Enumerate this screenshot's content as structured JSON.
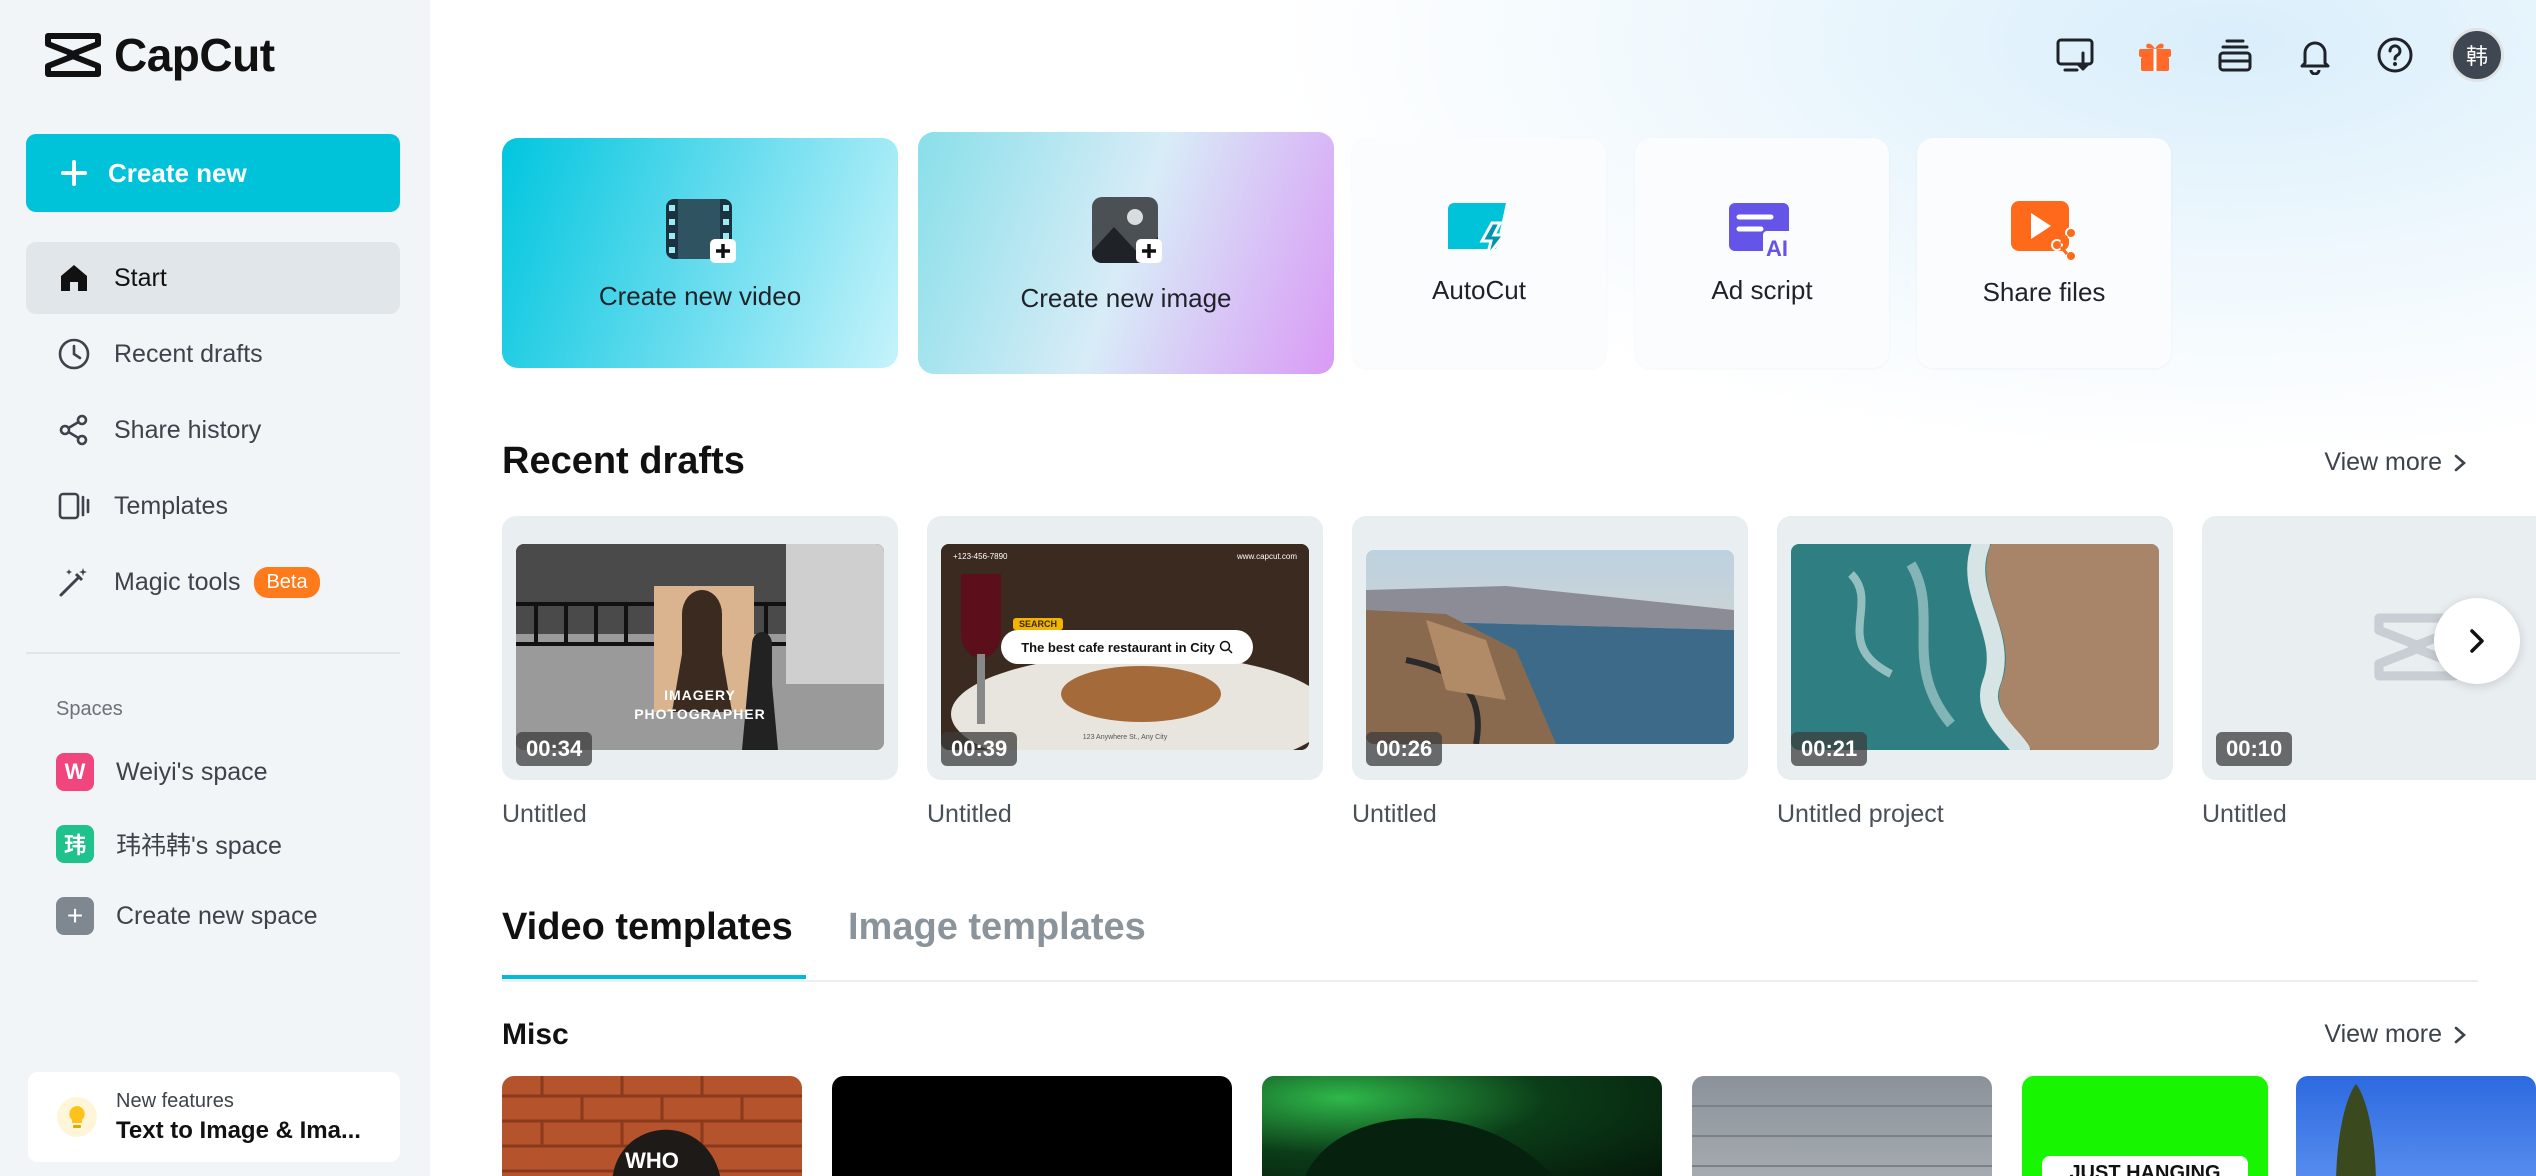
{
  "app": {
    "name": "CapCut"
  },
  "sidebar": {
    "create_label": "Create new",
    "nav": [
      {
        "label": "Start",
        "icon": "home-icon",
        "active": true
      },
      {
        "label": "Recent drafts",
        "icon": "clock-icon"
      },
      {
        "label": "Share history",
        "icon": "share-icon"
      },
      {
        "label": "Templates",
        "icon": "templates-icon"
      },
      {
        "label": "Magic tools",
        "icon": "magic-wand-icon",
        "badge": "Beta"
      }
    ],
    "spaces_label": "Spaces",
    "spaces": [
      {
        "initial": "W",
        "label": "Weiyi's space",
        "color": "#f0467d"
      },
      {
        "initial": "玮",
        "label": "玮祎韩's space",
        "color": "#1fc28b"
      },
      {
        "initial": "+",
        "label": "Create new space",
        "color": "#7f8790"
      }
    ],
    "feature": {
      "small": "New features",
      "big": "Text to Image & Ima..."
    }
  },
  "topbar": {
    "icons": [
      "desktop-download-icon",
      "gift-icon",
      "layers-icon",
      "bell-icon",
      "help-icon"
    ],
    "avatar_text": "韩"
  },
  "quick_actions": {
    "video": "Create new video",
    "image": "Create new image",
    "autocut": "AutoCut",
    "ad_script": "Ad script",
    "share_files": "Share files"
  },
  "recent": {
    "title": "Recent drafts",
    "view_more": "View more",
    "drafts": [
      {
        "name": "Untitled",
        "duration": "00:34",
        "overlay_line1": "IMAGERY",
        "overlay_line2": "PHOTOGRAPHER"
      },
      {
        "name": "Untitled",
        "duration": "00:39",
        "search_tag": "SEARCH",
        "search_text": "The best cafe restaurant in City",
        "small_top": "www.capcut.com",
        "small_bottom": "123 Anywhere St., Any City"
      },
      {
        "name": "Untitled",
        "duration": "00:26"
      },
      {
        "name": "Untitled project",
        "duration": "00:21"
      },
      {
        "name": "Untitled",
        "duration": "00:10"
      }
    ]
  },
  "templates": {
    "tabs": [
      "Video templates",
      "Image templates"
    ],
    "section": "Misc",
    "view_more": "View more",
    "thumb_text_1": "WHO",
    "thumb_text_5": "JUST HANGING"
  },
  "colors": {
    "accent": "#00c3da",
    "beta": "#ff7a1a",
    "gift": "#ff6a2b"
  }
}
